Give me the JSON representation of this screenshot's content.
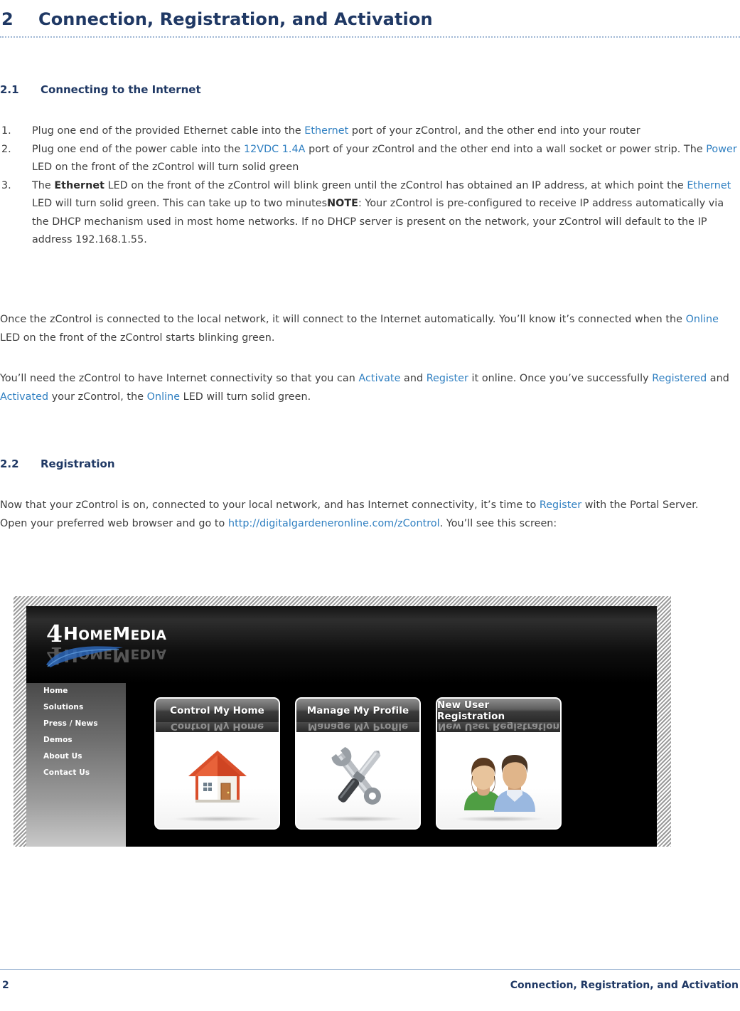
{
  "chapter": {
    "number": "2",
    "title": "Connection, Registration, and Activation"
  },
  "sections": {
    "s21": {
      "number": "2.1",
      "title": "Connecting to the Internet"
    },
    "s22": {
      "number": "2.2",
      "title": "Registration"
    }
  },
  "steps": [
    {
      "marker": "1.",
      "parts": [
        {
          "t": "Plug one end of the provided Ethernet cable into the ",
          "s": "n"
        },
        {
          "t": "Ethernet",
          "s": "link"
        },
        {
          "t": " port of your zControl, and the other end into your router",
          "s": "n"
        }
      ]
    },
    {
      "marker": "2.",
      "parts": [
        {
          "t": "Plug one end of the power cable into the ",
          "s": "n"
        },
        {
          "t": "12VDC 1.4A",
          "s": "link"
        },
        {
          "t": " port of your zControl and the other end into a wall socket or power strip. The ",
          "s": "n"
        },
        {
          "t": "Power",
          "s": "link"
        },
        {
          "t": " LED on the front of the zControl will turn solid green",
          "s": "n"
        }
      ]
    },
    {
      "marker": "3.",
      "parts": [
        {
          "t": "The ",
          "s": "n"
        },
        {
          "t": "Ethernet",
          "s": "bold"
        },
        {
          "t": " LED on the front of the zControl will blink green until the zControl has obtained an IP address, at which point the ",
          "s": "n"
        },
        {
          "t": "Ethernet",
          "s": "link"
        },
        {
          "t": " LED will turn solid green. This can take up to two minutes",
          "s": "n"
        },
        {
          "t": "NOTE",
          "s": "bold"
        },
        {
          "t": ": Your zControl is pre-configured to receive IP address automatically via the DHCP mechanism used in most home networks. If no DHCP server is present on the network, your zControl will default to the IP address 192.168.1.55.",
          "s": "n"
        }
      ]
    }
  ],
  "paragraphs": {
    "a": [
      {
        "t": "Once the zControl is connected to the local network, it will connect to the Internet automatically. You’ll know it’s connected when the ",
        "s": "n"
      },
      {
        "t": "Online",
        "s": "link"
      },
      {
        "t": " LED on the front of the zControl starts blinking green.",
        "s": "n"
      }
    ],
    "b": [
      {
        "t": "You’ll need the zControl to have Internet connectivity so that you can ",
        "s": "n"
      },
      {
        "t": "Activate",
        "s": "link"
      },
      {
        "t": " and ",
        "s": "n"
      },
      {
        "t": "Register",
        "s": "link"
      },
      {
        "t": " it online. Once you’ve successfully ",
        "s": "n"
      },
      {
        "t": "Registered",
        "s": "link"
      },
      {
        "t": " and ",
        "s": "n"
      },
      {
        "t": "Activated",
        "s": "link"
      },
      {
        "t": " your zControl, the ",
        "s": "n"
      },
      {
        "t": "Online",
        "s": "link"
      },
      {
        "t": " LED will turn solid green.",
        "s": "n"
      }
    ],
    "c": [
      {
        "t": "Now that your zControl is on, connected to your local network, and has Internet connectivity, it’s time to ",
        "s": "n"
      },
      {
        "t": "Register",
        "s": "link"
      },
      {
        "t": " with the Portal Server.",
        "s": "n"
      },
      {
        "t": "\n",
        "s": "br"
      },
      {
        "t": "Open your preferred web browser and go to ",
        "s": "n"
      },
      {
        "t": "http://digitalgardeneronline.com/zControl",
        "s": "link"
      },
      {
        "t": ". You’ll see this screen:",
        "s": "n"
      }
    ]
  },
  "figure": {
    "name": "4homemedia-portal-screenshot",
    "logo": {
      "numeral": "4",
      "lead": "H",
      "rest": "OME",
      "lead2": "M",
      "rest2": "EDIA"
    },
    "nav": [
      {
        "label": "Home"
      },
      {
        "label": "Solutions"
      },
      {
        "label": "Press / News"
      },
      {
        "label": "Demos"
      },
      {
        "label": "About Us"
      },
      {
        "label": "Contact Us"
      }
    ],
    "cards": [
      {
        "title": "Control My Home",
        "icon": "house-icon"
      },
      {
        "title": "Manage My Profile",
        "icon": "tools-icon"
      },
      {
        "title": "New User Registration",
        "icon": "users-icon"
      }
    ]
  },
  "footer": {
    "page_number": "2",
    "title": "Connection, Registration, and Activation"
  },
  "colors": {
    "heading": "#1f3864",
    "link": "#2f7fc1",
    "body": "#3d3d3d",
    "rule": "#9fb7d4"
  }
}
